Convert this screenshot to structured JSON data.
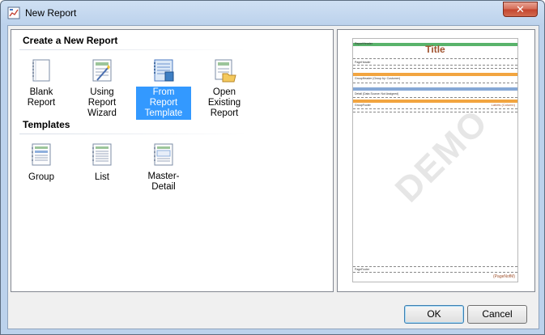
{
  "window": {
    "title": "New Report",
    "close_glyph": "✕",
    "icon": "report-app-icon"
  },
  "sections": {
    "create": {
      "title": "Create a New Report",
      "items": [
        {
          "label": "Blank Report",
          "icon": "blank-report-icon",
          "selected": false
        },
        {
          "label": "Using Report\nWizard",
          "icon": "report-wizard-icon",
          "selected": false
        },
        {
          "label": "From Report\nTemplate",
          "icon": "report-template-icon",
          "selected": true
        },
        {
          "label": "Open Existing\nReport",
          "icon": "open-report-icon",
          "selected": false
        }
      ]
    },
    "templates": {
      "title": "Templates",
      "items": [
        {
          "label": "Group",
          "icon": "group-template-icon"
        },
        {
          "label": "List",
          "icon": "list-template-icon"
        },
        {
          "label": "Master-Detail",
          "icon": "master-detail-template-icon"
        }
      ]
    }
  },
  "preview": {
    "title": "Title",
    "watermark": "DEMO",
    "page_footer_text": "(PageNofM)",
    "column_label": "Labels (Column)",
    "band_labels": {
      "report_header": "ReportHeader",
      "page_header": "PageHeader",
      "group_header": "GroupHeader (Group by: Customer)",
      "detail": "Detail (Data Source: Not Assigned)",
      "group_footer": "GroupFooter",
      "page_footer": "PageFooter"
    }
  },
  "buttons": {
    "ok": "OK",
    "cancel": "Cancel"
  },
  "colors": {
    "selection": "#3399ff",
    "band_green": "#59b36b",
    "band_blue": "#86a8d6",
    "band_orange": "#f2a540",
    "title_brown": "#a0522d"
  }
}
